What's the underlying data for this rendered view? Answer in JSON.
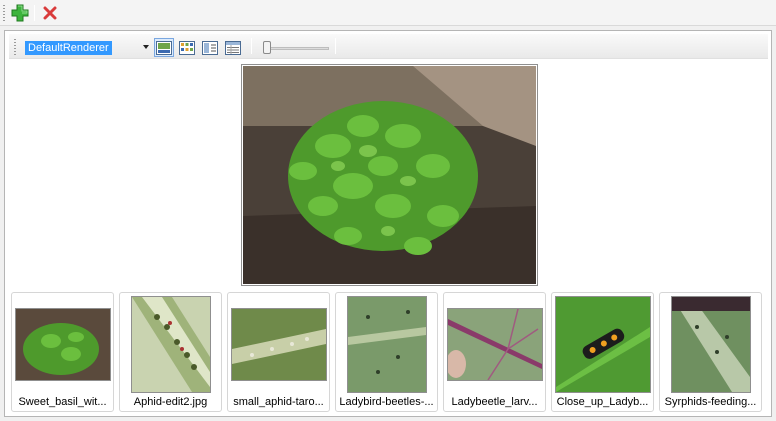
{
  "toolbar": {
    "add_icon": "green-plus-icon",
    "remove_icon": "red-x-icon",
    "colors": {
      "add": "#2fa832",
      "remove": "#d93b3b"
    }
  },
  "view_toolbar": {
    "renderer_selected": "DefaultRenderer",
    "view_icons": [
      "thumbnail-view-icon",
      "gallery-view-icon",
      "pane-view-icon",
      "details-view-icon"
    ],
    "active_view": "thumbnail-view-icon",
    "zoom_level": 0.0
  },
  "preview": {
    "image_icon": "basil-plant-photo"
  },
  "thumbnails": [
    {
      "caption": "Sweet_basil_wit...",
      "image": "basil-plant"
    },
    {
      "caption": "Aphid-edit2.jpg",
      "image": "aphids-on-stem"
    },
    {
      "caption": "small_aphid-taro...",
      "image": "aphid-taro"
    },
    {
      "caption": "Ladybird-beetles-...",
      "image": "ladybird-beetles-leaf"
    },
    {
      "caption": "Ladybeetle_larv...",
      "image": "ladybeetle-larva-leaf"
    },
    {
      "caption": "Close_up_Ladyb...",
      "image": "ladybird-larva-closeup"
    },
    {
      "caption": "Syrphids-feeding...",
      "image": "syrphids-leaf"
    }
  ]
}
